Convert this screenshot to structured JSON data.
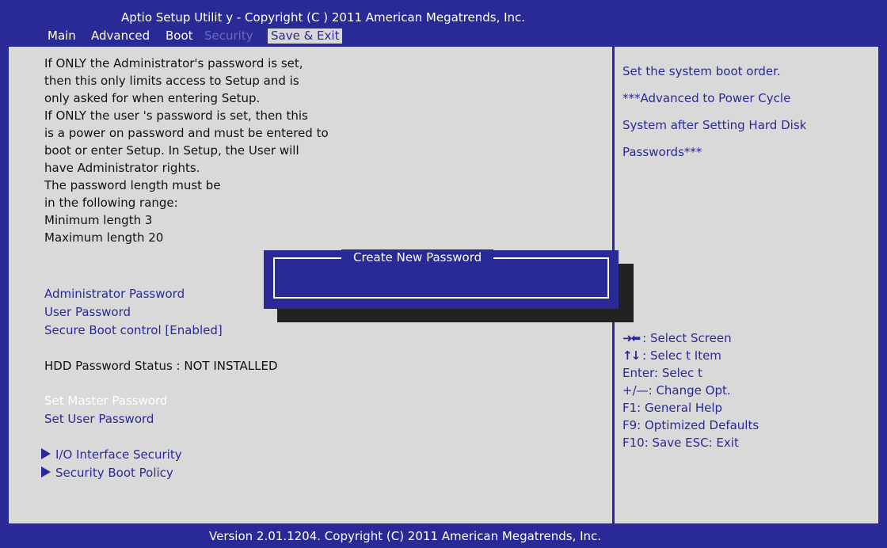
{
  "header": {
    "title": "Aptio Setup Utilit y - Copyright (C ) 2011 American Megatrends, Inc.",
    "menu": [
      "Main",
      "Advanced",
      "Boot",
      "Security",
      "Save & Exit"
    ]
  },
  "left": {
    "help_lines": [
      "If ONLY the Administrator's password is set,",
      "then this only limits access to Setup and is",
      "only asked for when entering Setup.",
      "If ONLY the user 's password is set, then this",
      "is a power on password and must be entered to",
      "boot or enter Setup. In Setup, the User will",
      "have Administrator rights.",
      "The password length must be",
      "in the following range:",
      "Minimum length  3",
      "Maximum length  20"
    ],
    "administrator_password": "Administrator Password",
    "user_password": "User Password",
    "secure_boot_control": "Secure Boot control  [Enabled]",
    "hdd_password_status": "HDD Password Status :  NOT INSTALLED",
    "set_master_password": "Set Master Password",
    "set_user_password": "Set User Password",
    "io_interface_security": "I/O Interface Security",
    "security_boot_policy": "Security Boot Policy"
  },
  "right_help": [
    "Set the system boot order.",
    "***Advanced to Power Cycle",
    "System after Setting Hard Disk",
    "Passwords***"
  ],
  "keys": {
    "select_screen": ": Select Screen",
    "select_item": ":  Selec t Item",
    "enter": "Enter: Selec t",
    "change_opt": "+/—:  Change Opt.",
    "f1": "F1:  General Help",
    "f9": "F9:  Optimized Defaults",
    "f10": "F10:  Save   ESC:  Exit"
  },
  "dialog": {
    "title": "Create New Password",
    "input_value": ""
  },
  "footer": "Version 2.01.1204. Copyright (C) 2011 American Megatrends, Inc."
}
